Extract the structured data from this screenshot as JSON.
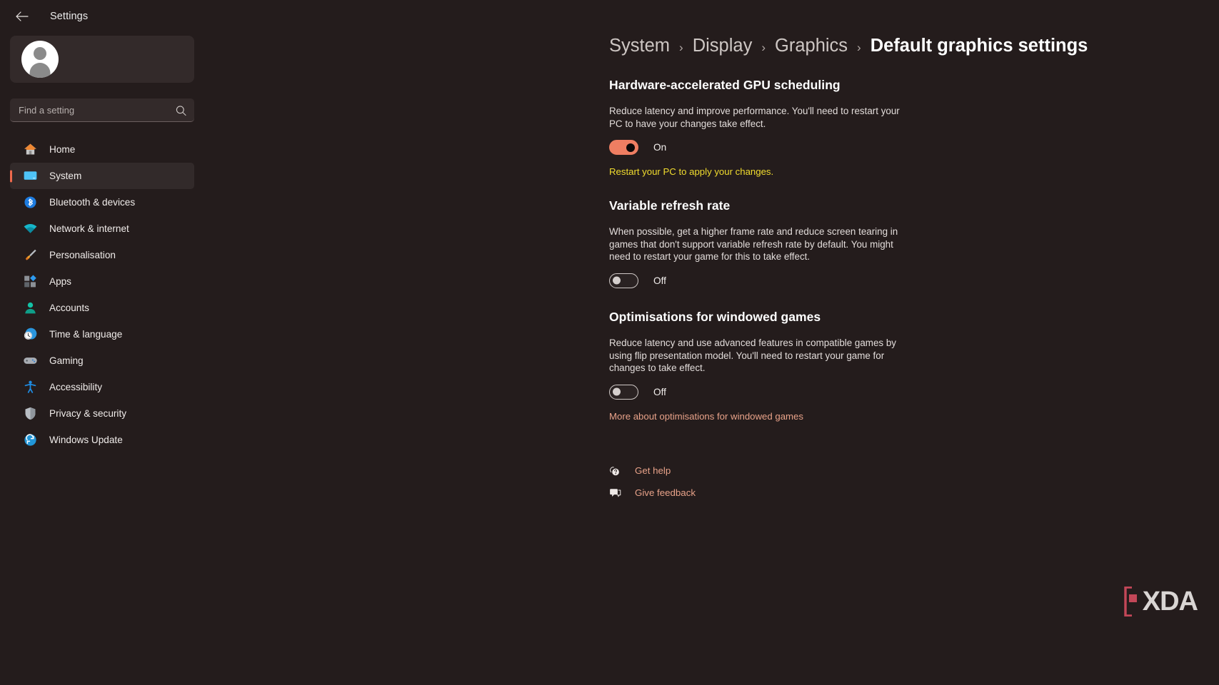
{
  "window": {
    "title": "Settings",
    "back_icon": "back-arrow-icon"
  },
  "sidebar": {
    "account": {
      "avatar_icon": "user-avatar-icon"
    },
    "search": {
      "placeholder": "Find a setting",
      "value": "",
      "icon": "search-icon"
    },
    "items": [
      {
        "label": "Home",
        "icon": "home-icon",
        "selected": false
      },
      {
        "label": "System",
        "icon": "system-monitor-icon",
        "selected": true
      },
      {
        "label": "Bluetooth & devices",
        "icon": "bluetooth-icon",
        "selected": false
      },
      {
        "label": "Network & internet",
        "icon": "wifi-icon",
        "selected": false
      },
      {
        "label": "Personalisation",
        "icon": "paintbrush-icon",
        "selected": false
      },
      {
        "label": "Apps",
        "icon": "apps-icon",
        "selected": false
      },
      {
        "label": "Accounts",
        "icon": "account-person-icon",
        "selected": false
      },
      {
        "label": "Time & language",
        "icon": "clock-globe-icon",
        "selected": false
      },
      {
        "label": "Gaming",
        "icon": "gamepad-icon",
        "selected": false
      },
      {
        "label": "Accessibility",
        "icon": "accessibility-person-icon",
        "selected": false
      },
      {
        "label": "Privacy & security",
        "icon": "shield-icon",
        "selected": false
      },
      {
        "label": "Windows Update",
        "icon": "update-refresh-icon",
        "selected": false
      }
    ]
  },
  "breadcrumb": {
    "items": [
      "System",
      "Display",
      "Graphics",
      "Default graphics settings"
    ],
    "separator": "›",
    "current_index": 3
  },
  "sections": [
    {
      "title": "Hardware-accelerated GPU scheduling",
      "description": "Reduce latency and improve performance. You'll need to restart your PC to have your changes take effect.",
      "toggle": {
        "state": "on",
        "label": "On"
      },
      "warning": "Restart your PC to apply your changes.",
      "link": null
    },
    {
      "title": "Variable refresh rate",
      "description": "When possible, get a higher frame rate and reduce screen tearing in games that don't support variable refresh rate by default. You might need to restart your game for this to take effect.",
      "toggle": {
        "state": "off",
        "label": "Off"
      },
      "warning": null,
      "link": null
    },
    {
      "title": "Optimisations for windowed games",
      "description": "Reduce latency and use advanced features in compatible games by using flip presentation model. You'll need to restart your game for changes to take effect.",
      "toggle": {
        "state": "off",
        "label": "Off"
      },
      "warning": null,
      "link": "More about optimisations for windowed games"
    }
  ],
  "help": {
    "get_help": {
      "label": "Get help",
      "icon": "help-question-icon"
    },
    "give_feedback": {
      "label": "Give feedback",
      "icon": "feedback-icon"
    }
  },
  "watermark": {
    "text": "XDA",
    "bracket_icon": "xda-bracket-icon"
  },
  "colors": {
    "accent": "#ef7e62",
    "link": "#e8a289",
    "warning": "#f2dd2e",
    "background": "#241c1c",
    "sidebar_selected": "#322a2a"
  }
}
